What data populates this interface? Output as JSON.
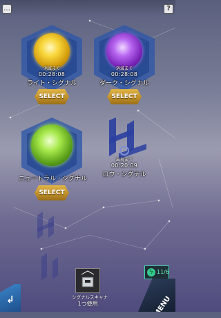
{
  "header": {
    "chat_icon": "chat-icon",
    "help_label": "?"
  },
  "signals": [
    {
      "name": "ライト・シグナル",
      "until_label": "消滅まで",
      "time": "00:28:08",
      "button": "SELECT",
      "orb_color": "#f2c21a",
      "hex_color": "#2f58a8"
    },
    {
      "name": "ダーク・シグナル",
      "until_label": "消滅まで",
      "time": "00:28:08",
      "button": "SELECT",
      "orb_color": "#9b3ad8",
      "hex_color": "#2f58a8"
    },
    {
      "name": "ニュートラル・シグナル",
      "until_label": "",
      "button": "SELECT",
      "orb_color": "#7fd52b",
      "hex_color": "#2f58a8"
    },
    {
      "name": "ロウ・シグナル",
      "until_label": "出現まで",
      "time": "00:20:09",
      "orb_color": "#2a3fa0"
    }
  ],
  "scanner": {
    "line1": "シグナルスキャナ",
    "line2": "1つ使用"
  },
  "energy": {
    "value": "11/6"
  },
  "menu": {
    "label": "MENU"
  },
  "back": {
    "icon": "return-arrow-icon"
  }
}
